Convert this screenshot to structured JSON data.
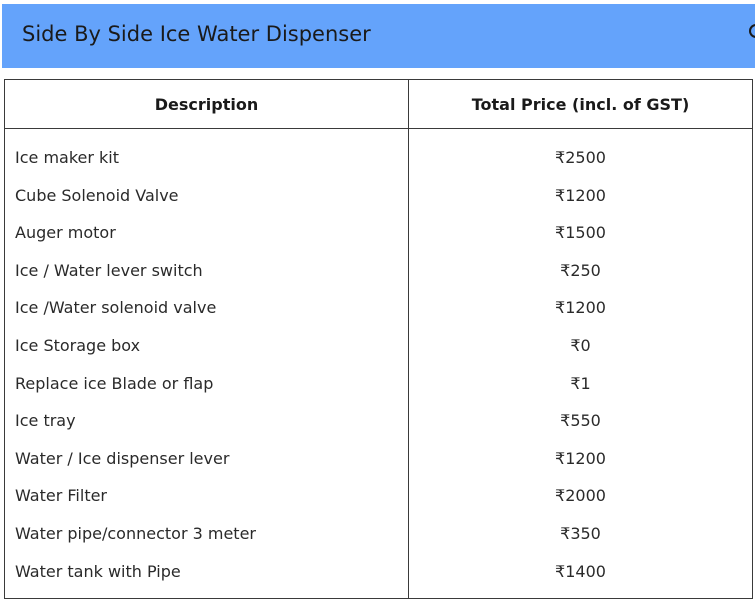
{
  "header": {
    "title": "Side By Side Ice Water Dispenser",
    "background": "#64a3fb"
  },
  "table": {
    "columns": [
      "Description",
      "Total Price (incl. of GST)"
    ],
    "rows": [
      {
        "description": "Ice maker kit",
        "price": "₹2500"
      },
      {
        "description": "Cube Solenoid Valve",
        "price": "₹1200"
      },
      {
        "description": "Auger motor",
        "price": "₹1500"
      },
      {
        "description": "Ice / Water lever switch",
        "price": "₹250"
      },
      {
        "description": "Ice /Water solenoid valve",
        "price": "₹1200"
      },
      {
        "description": "Ice Storage box",
        "price": "₹0"
      },
      {
        "description": "Replace ice Blade or flap",
        "price": "₹1"
      },
      {
        "description": "Ice tray",
        "price": "₹550"
      },
      {
        "description": "Water / Ice dispenser lever",
        "price": "₹1200"
      },
      {
        "description": "Water Filter",
        "price": "₹2000"
      },
      {
        "description": "Water pipe/connector 3 meter",
        "price": "₹350"
      },
      {
        "description": "Water tank with Pipe",
        "price": "₹1400"
      }
    ]
  }
}
